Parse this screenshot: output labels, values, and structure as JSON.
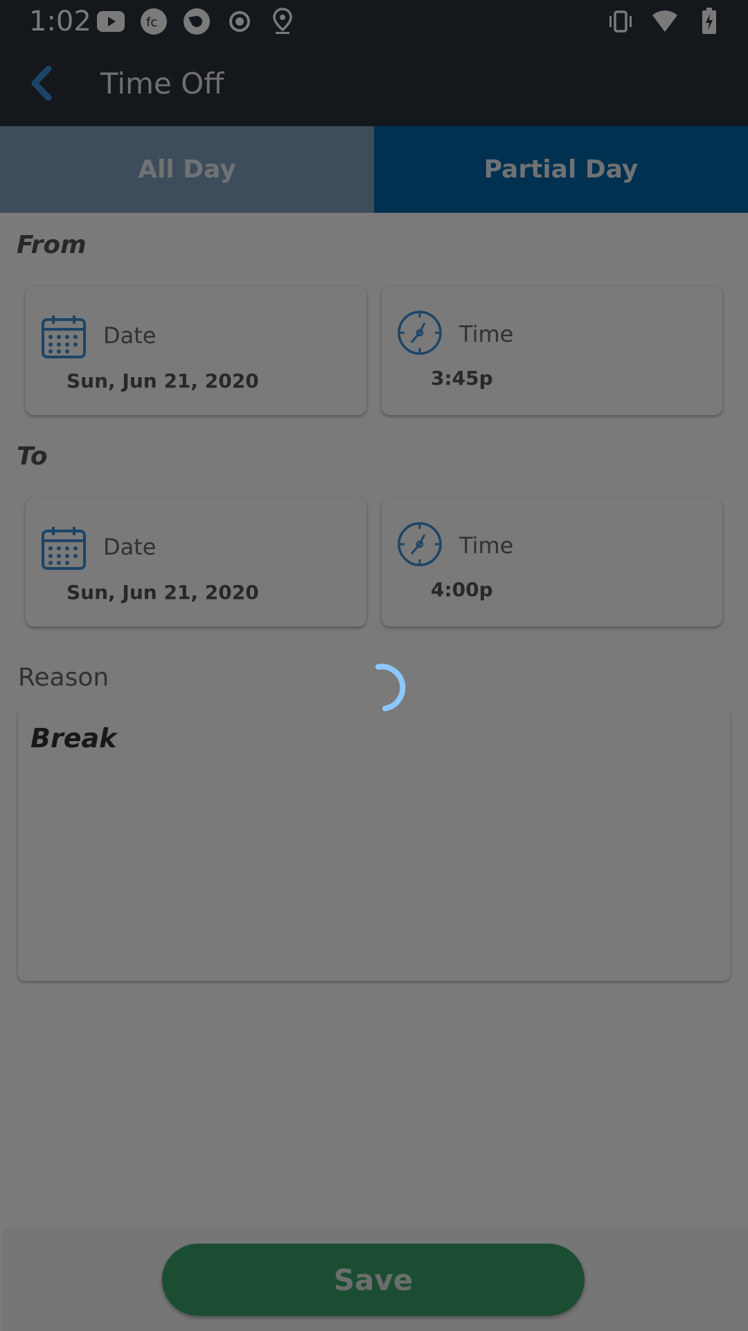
{
  "status_bar": {
    "time": "1:02",
    "left_icons": [
      "youtube-icon",
      "fc-app-icon",
      "camera-shutter-icon",
      "record-icon",
      "location-pin-icon"
    ],
    "right_icons": [
      "vibrate-icon",
      "wifi-icon",
      "battery-charging-icon"
    ]
  },
  "app_bar": {
    "title": "Time Off",
    "back_icon": "chevron-left-icon"
  },
  "tabs": {
    "all_day": "All Day",
    "partial_day": "Partial Day",
    "selected": "Partial Day"
  },
  "from": {
    "label": "From",
    "date_caption": "Date",
    "date_value": "Sun, Jun 21, 2020",
    "time_caption": "Time",
    "time_value": "3:45p"
  },
  "to": {
    "label": "To",
    "date_caption": "Date",
    "date_value": "Sun, Jun 21, 2020",
    "time_caption": "Time",
    "time_value": "4:00p"
  },
  "reason": {
    "label": "Reason",
    "value": "Break"
  },
  "save_button": "Save",
  "colors": {
    "app_bar_bg": "#2a313c",
    "tab_inactive": "#7fa1bf",
    "tab_active": "#0066a8",
    "icon_blue": "#3b8ed6",
    "save_green": "#3aa26a",
    "spinner": "#8cc8ff"
  }
}
